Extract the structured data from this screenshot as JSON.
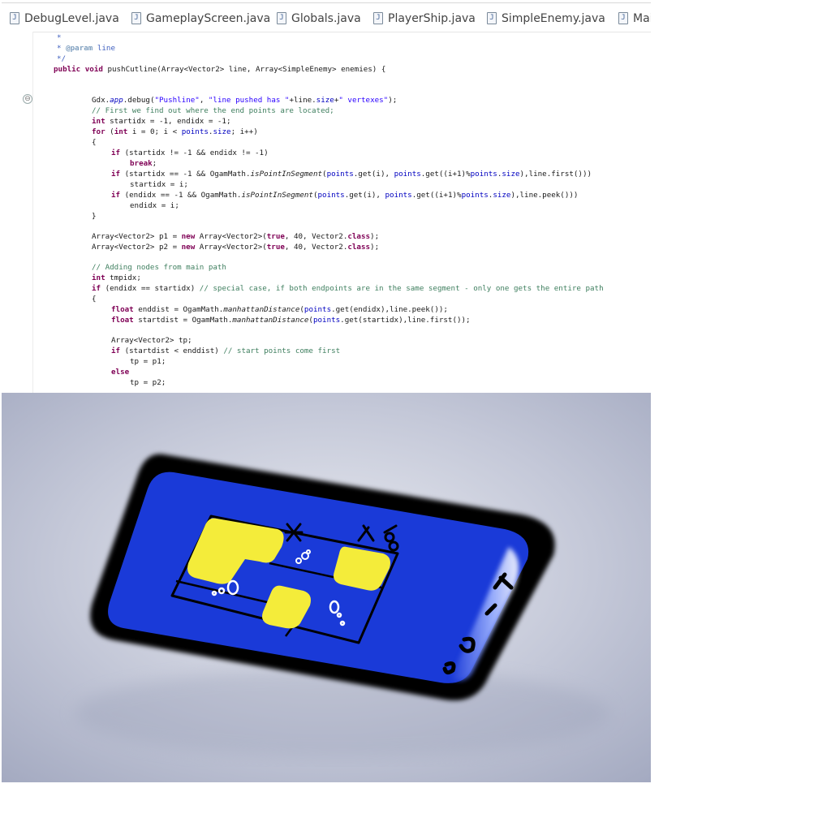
{
  "tabs": [
    {
      "label": "DebugLevel.java"
    },
    {
      "label": "GameplayScreen.java"
    },
    {
      "label": "Globals.java"
    },
    {
      "label": "PlayerShip.java"
    },
    {
      "label": "SimpleEnemy.java"
    },
    {
      "label": "Mai"
    }
  ],
  "tab_icon_glyph": "J",
  "fold_glyph": "⊖",
  "colors": {
    "keyword": "#7f0055",
    "comment": "#3f7f5f",
    "javadoc": "#3f5fbf",
    "string": "#2a00ff",
    "field": "#0000c0",
    "phone_body": "#1a3ad8",
    "phone_frame": "#000000",
    "highlight_yellow": "#f4ec3a",
    "background_top": "#a9b0c6"
  },
  "code": {
    "jd_star": "*",
    "jd_param_tag": "@param",
    "jd_param_name": "line",
    "jd_end": "*/",
    "sig_kw1": "public",
    "sig_kw2": "void",
    "sig_rest": "pushCutline(Array<Vector2> line, Array<SimpleEnemy> enemies) {",
    "l1_a": "Gdx.",
    "l1_app": "app",
    "l1_b": ".debug(",
    "l1_s1": "\"Pushline\"",
    "l1_c": ", ",
    "l1_s2": "\"line pushed has \"",
    "l1_d": "+line.",
    "l1_size": "size",
    "l1_e": "+",
    "l1_s3": "\" vertexes\"",
    "l1_f": ");",
    "l2": "// First we find out where the end points are located;",
    "l3_kw": "int",
    "l3_rest": " startidx = -1, endidx = -1;",
    "l4_kw": "for",
    "l4_a": " (",
    "l4_kw2": "int",
    "l4_b": " i = 0; i < ",
    "l4_pts": "points",
    "l4_c": ".",
    "l4_size": "size",
    "l4_d": "; i++)",
    "l5": "{",
    "l6_kw": "if",
    "l6_rest": " (startidx != -1 && endidx != -1)",
    "l7_kw": "break",
    "l7_rest": ";",
    "l8_kw": "if",
    "l8_a": " (startidx == -1 && OgamMath.",
    "l8_m": "isPointInSegment",
    "l8_b": "(",
    "l8_p1": "points",
    "l8_c": ".get(i), ",
    "l8_p2": "points",
    "l8_d": ".get((i+1)%",
    "l8_p3": "points",
    "l8_e": ".",
    "l8_size": "size",
    "l8_f": "),line.first()))",
    "l9": "startidx = i;",
    "l10_kw": "if",
    "l10_a": " (endidx == -1 && OgamMath.",
    "l10_m": "isPointInSegment",
    "l10_b": "(",
    "l10_p1": "points",
    "l10_c": ".get(i), ",
    "l10_p2": "points",
    "l10_d": ".get((i+1)%",
    "l10_p3": "points",
    "l10_e": ".",
    "l10_size": "size",
    "l10_f": "),line.peek()))",
    "l11": "endidx = i;",
    "l12": "}",
    "l13_a": "Array<Vector2> p1 = ",
    "l13_kw": "new",
    "l13_b": " Array<Vector2>(",
    "l13_kw2": "true",
    "l13_c": ", 40, Vector2.",
    "l13_kw3": "class",
    "l13_d": ");",
    "l14_a": "Array<Vector2> p2 = ",
    "l14_kw": "new",
    "l14_b": " Array<Vector2>(",
    "l14_kw2": "true",
    "l14_c": ", 40, Vector2.",
    "l14_kw3": "class",
    "l14_d": ");",
    "l15": "// Adding nodes from main path",
    "l16_kw": "int",
    "l16_rest": " tmpidx;",
    "l17_kw": "if",
    "l17_rest": " (endidx == startidx) ",
    "l17_cm": "// special case, if both endpoints are in the same segment - only one gets the entire path",
    "l18": "{",
    "l19_kw": "float",
    "l19_a": " enddist = OgamMath.",
    "l19_m": "manhattanDistance",
    "l19_b": "(",
    "l19_p": "points",
    "l19_c": ".get(endidx),line.peek());",
    "l20_kw": "float",
    "l20_a": " startdist = OgamMath.",
    "l20_m": "manhattanDistance",
    "l20_b": "(",
    "l20_p": "points",
    "l20_c": ".get(startidx),line.first());",
    "l21": "Array<Vector2> tp;",
    "l22_kw": "if",
    "l22_rest": " (startdist < enddist) ",
    "l22_cm": "// start points come first",
    "l23": "tp = p1;",
    "l24_kw": "else",
    "l25": "tp = p2;"
  },
  "sketch": {
    "description_icons": [
      "scissors-icon",
      "scissors-icon",
      "enemy-blob-icon"
    ]
  }
}
